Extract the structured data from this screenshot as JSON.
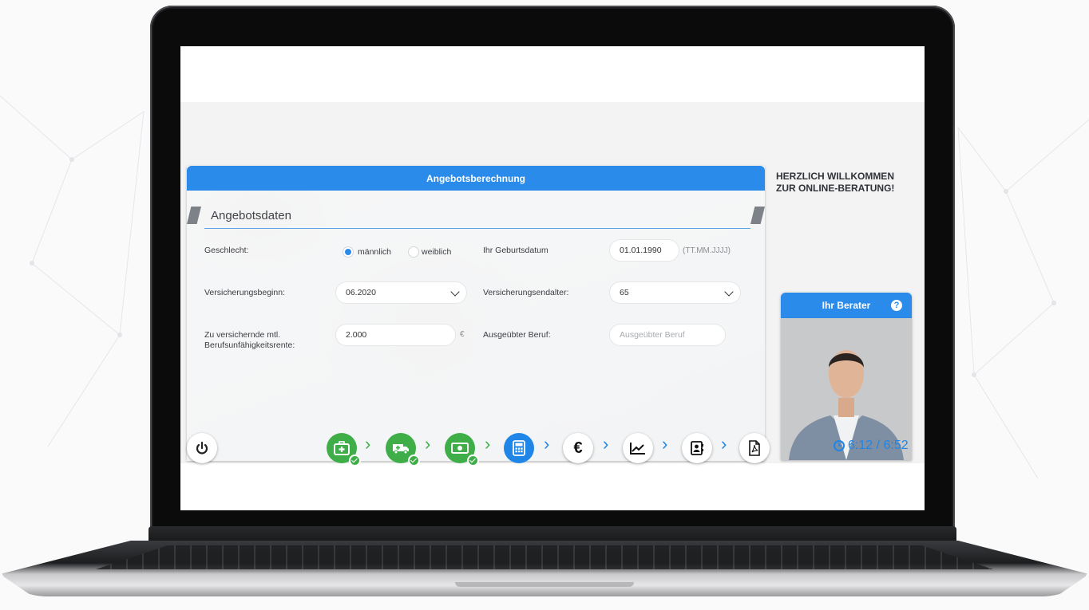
{
  "panel": {
    "title": "Angebotsberechnung",
    "section_title": "Angebotsdaten"
  },
  "form": {
    "gender_label": "Geschlecht:",
    "gender_options": [
      "männlich",
      "weiblich"
    ],
    "gender_selected": "männlich",
    "birthdate_label": "Ihr Geburtsdatum",
    "birthdate_value": "01.01.1990",
    "birthdate_format": "(TT.MM.JJJJ)",
    "start_label": "Versicherungsbeginn:",
    "start_value": "06.2020",
    "end_age_label": "Versicherungsendalter:",
    "end_age_value": "65",
    "pension_label_line1": "Zu versichernde mtl.",
    "pension_label_line2": "Berufsunfähigkeitsrente:",
    "pension_value": "2.000",
    "pension_currency": "€",
    "occupation_label": "Ausgeübter Beruf:",
    "occupation_placeholder": "Ausgeübter Beruf"
  },
  "welcome": {
    "line1": "HERZLICH WILLKOMMEN",
    "line2": "ZUR ONLINE-BERATUNG!"
  },
  "advisor": {
    "title": "Ihr Berater",
    "help_symbol": "?"
  },
  "timer": {
    "text": "6:12 / 6:52"
  },
  "steps": [
    {
      "icon": "medical-kit-icon",
      "state": "done"
    },
    {
      "icon": "ambulance-icon",
      "state": "done"
    },
    {
      "icon": "money-icon",
      "state": "done"
    },
    {
      "icon": "calculator-icon",
      "state": "current"
    },
    {
      "icon": "euro-icon",
      "state": "pending",
      "symbol": "€"
    },
    {
      "icon": "chart-icon",
      "state": "pending"
    },
    {
      "icon": "contact-card-icon",
      "state": "pending"
    },
    {
      "icon": "pdf-icon",
      "state": "pending"
    }
  ],
  "colors": {
    "primary_blue": "#2a8bea",
    "done_green": "#3fae49"
  }
}
